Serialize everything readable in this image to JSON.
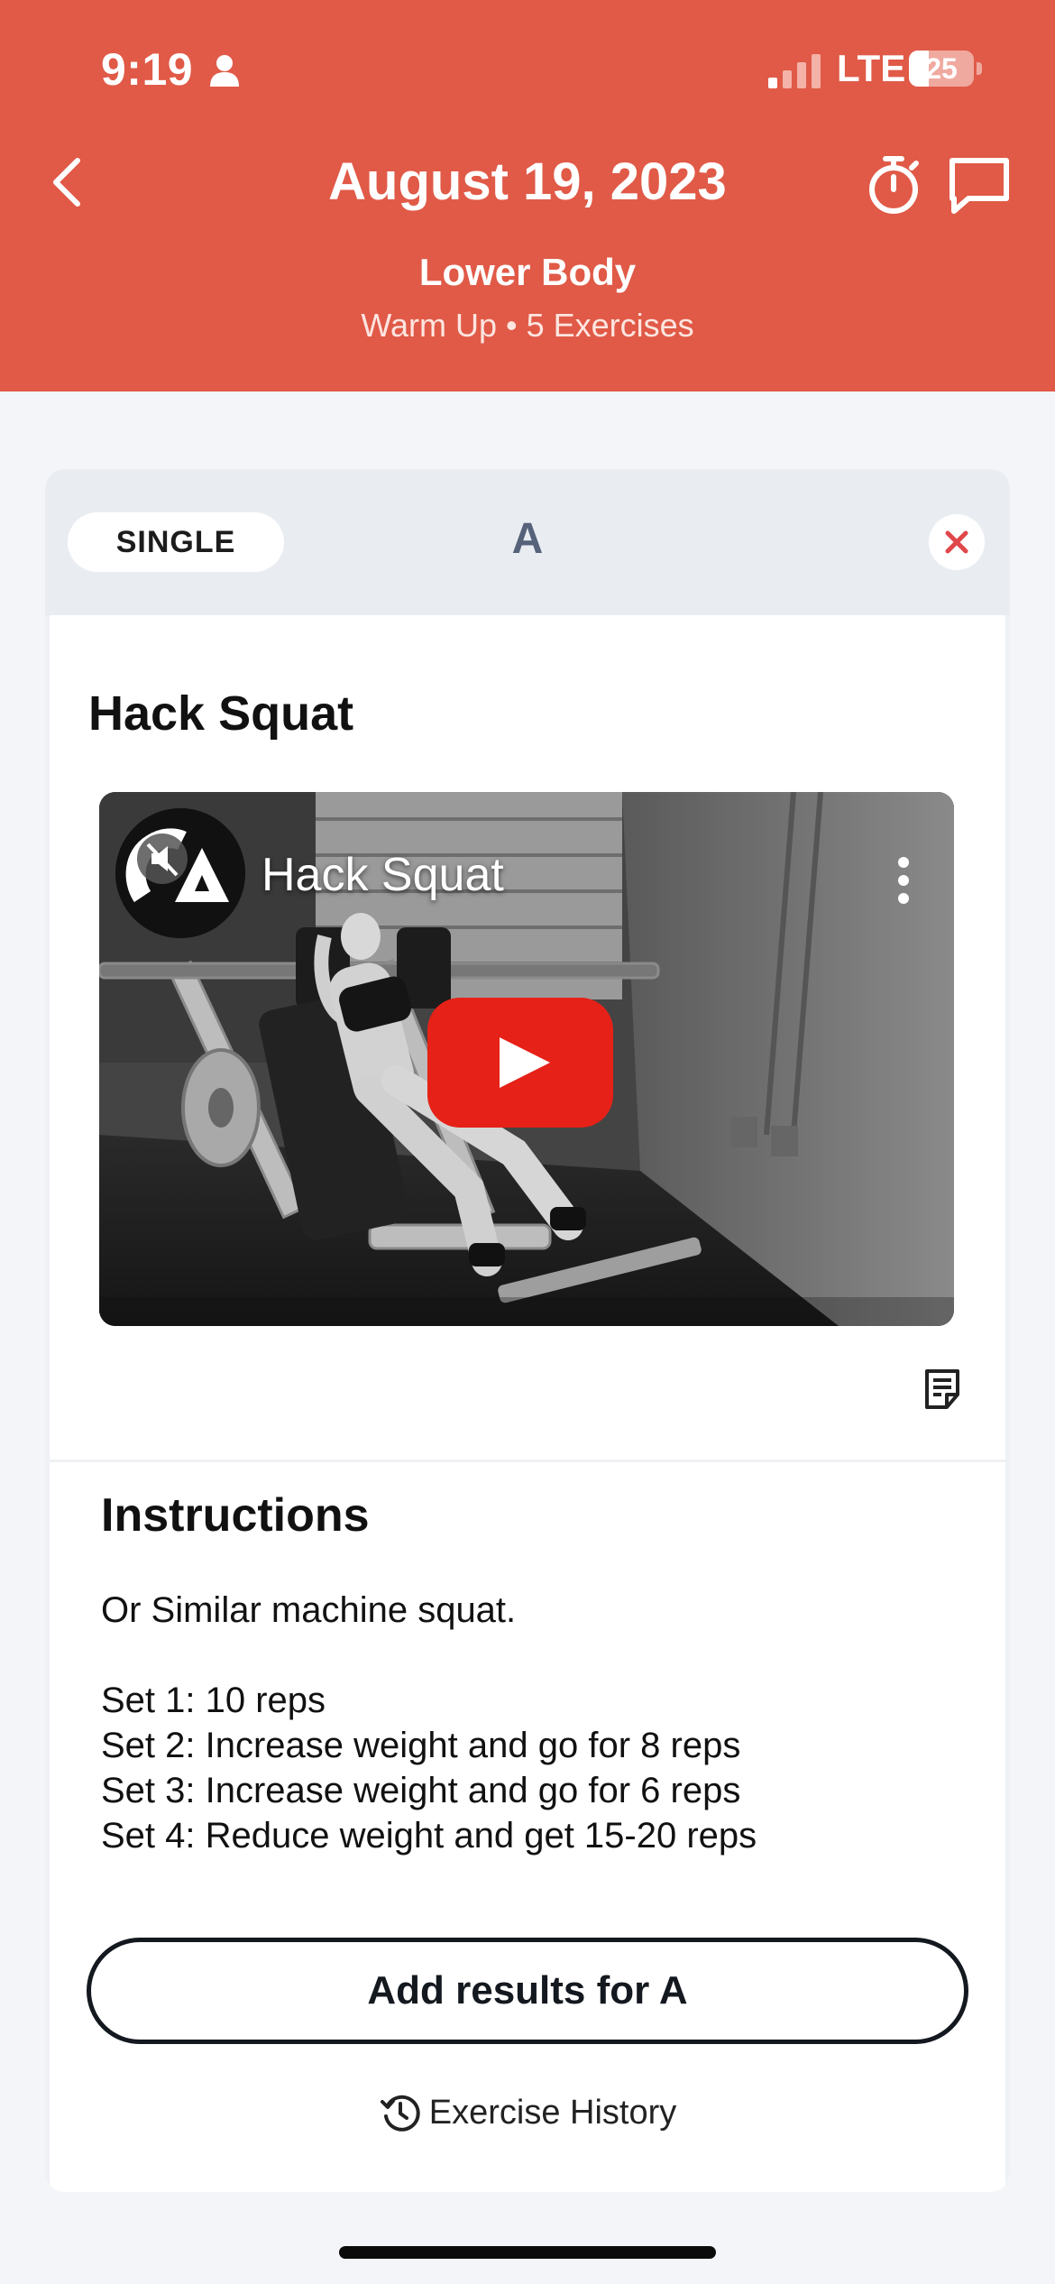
{
  "status_bar": {
    "time": "9:19",
    "network": "LTE",
    "battery": "25"
  },
  "header": {
    "title": "August 19, 2023",
    "subtitle": "Lower Body",
    "meta": "Warm Up • 5 Exercises",
    "icons": {
      "back": "chevron-left-icon",
      "timer": "stopwatch-icon",
      "chat": "chat-bubble-icon"
    },
    "background_color": "#e05a47"
  },
  "exercise_card": {
    "type_label": "SINGLE",
    "letter": "A",
    "exercise_name": "Hack Squat",
    "video": {
      "title": "Hack Squat"
    },
    "instructions": {
      "heading": "Instructions",
      "lines": [
        "Or Similar machine squat.",
        "",
        "Set 1: 10 reps",
        "Set 2: Increase weight and go for 8 reps",
        "Set 3: Increase weight and go for 6 reps",
        "Set 4: Reduce weight and get 15-20 reps"
      ]
    },
    "add_results_label": "Add results for A",
    "history_label": "Exercise History"
  },
  "colors": {
    "accent": "#e05a47",
    "close_x": "#e0474a",
    "letter": "#56617a",
    "play_button": "#e62117"
  }
}
